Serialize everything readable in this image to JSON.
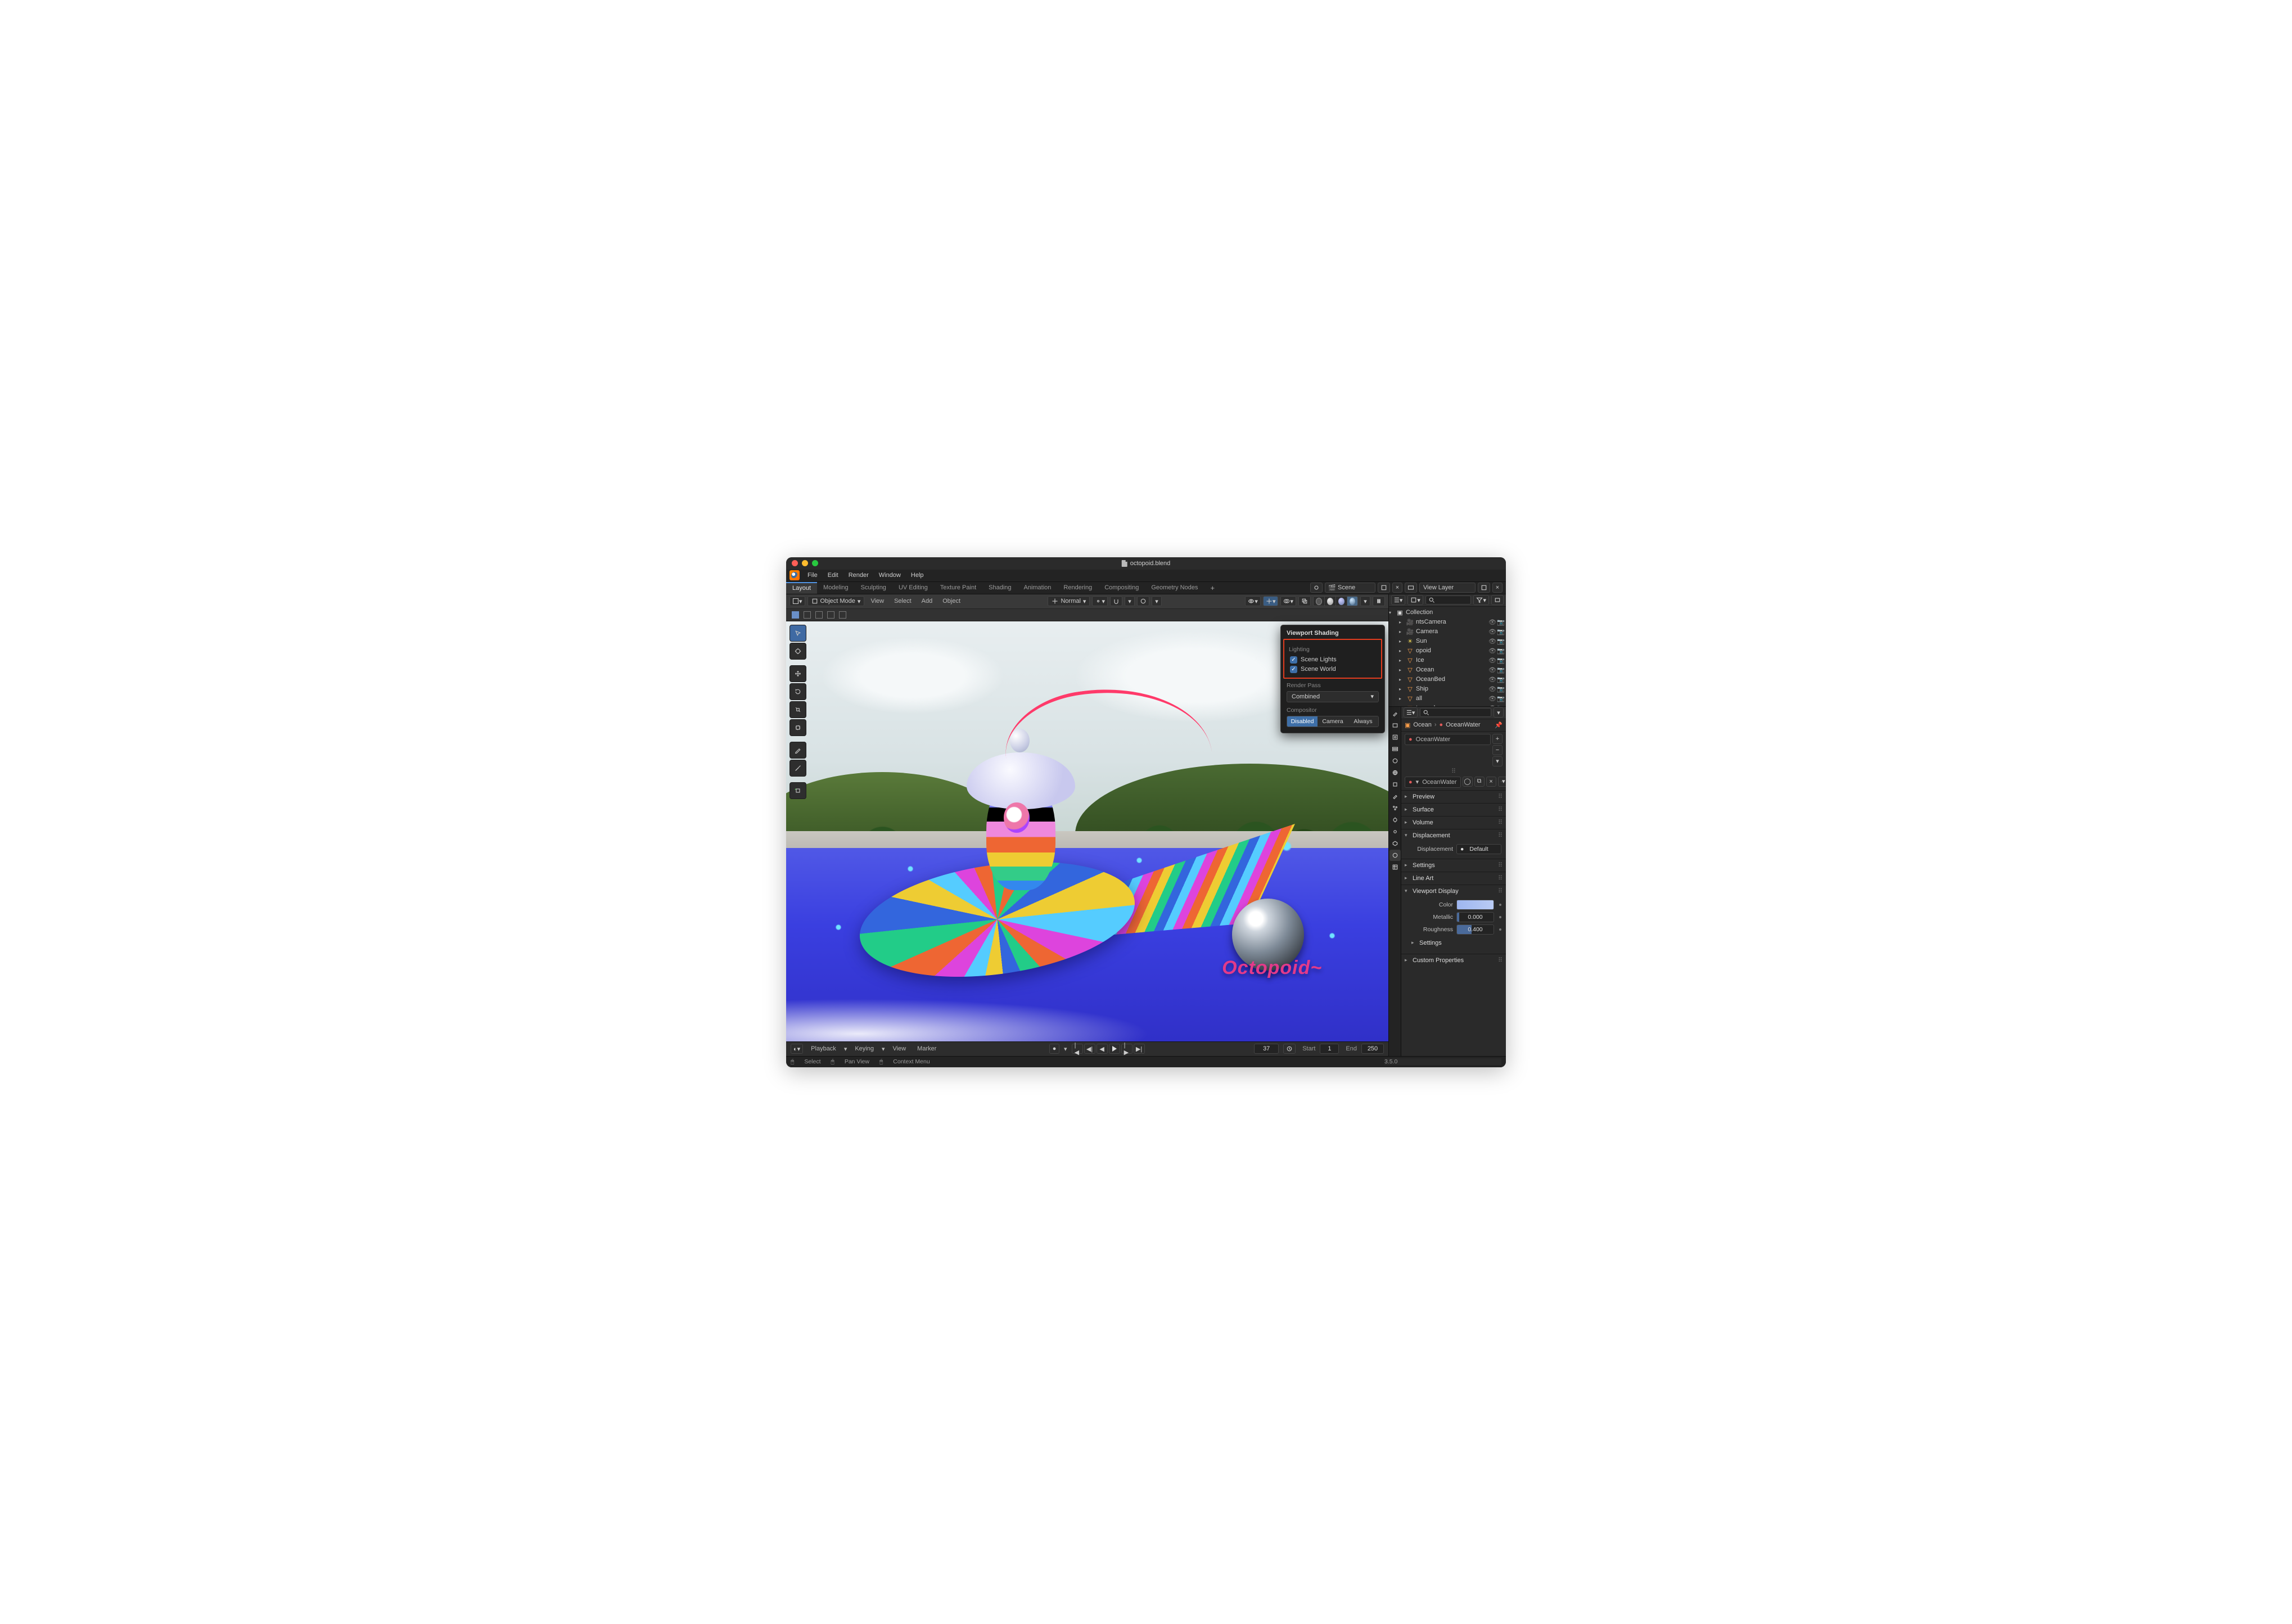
{
  "window": {
    "filename": "octopoid.blend"
  },
  "mainmenu": [
    "File",
    "Edit",
    "Render",
    "Window",
    "Help"
  ],
  "workspaces": {
    "tabs": [
      "Layout",
      "Modeling",
      "Sculpting",
      "UV Editing",
      "Texture Paint",
      "Shading",
      "Animation",
      "Rendering",
      "Compositing",
      "Geometry Nodes"
    ],
    "active": "Layout",
    "scene_label": "Scene",
    "viewlayer_label": "View Layer"
  },
  "viewport_header": {
    "mode": "Object Mode",
    "menus": [
      "View",
      "Select",
      "Add",
      "Object"
    ],
    "orientation": "Normal"
  },
  "popover": {
    "title": "Viewport Shading",
    "lighting_label": "Lighting",
    "scene_lights": "Scene Lights",
    "scene_world": "Scene World",
    "renderpass_label": "Render Pass",
    "renderpass_value": "Combined",
    "compositor_label": "Compositor",
    "comp_options": [
      "Disabled",
      "Camera",
      "Always"
    ],
    "comp_active": "Disabled"
  },
  "outliner": {
    "root": "Collection",
    "search_placeholder": "",
    "items": [
      {
        "name": "ntsCamera",
        "kind": "camera"
      },
      {
        "name": "Camera",
        "kind": "camera"
      },
      {
        "name": "Sun",
        "kind": "light"
      },
      {
        "name": "opoid",
        "kind": "mesh"
      },
      {
        "name": "Ice",
        "kind": "mesh"
      },
      {
        "name": "Ocean",
        "kind": "mesh"
      },
      {
        "name": "OceanBed",
        "kind": "mesh"
      },
      {
        "name": "Ship",
        "kind": "mesh"
      },
      {
        "name": "all",
        "kind": "mesh"
      },
      {
        "name": "termark",
        "kind": "mesh"
      }
    ]
  },
  "properties": {
    "crumb_object": "Ocean",
    "crumb_material": "OceanWater",
    "slot_material": "OceanWater",
    "datablock": "OceanWater",
    "panels": {
      "preview": "Preview",
      "surface": "Surface",
      "volume": "Volume",
      "displacement": "Displacement",
      "disp_label": "Displacement",
      "disp_value": "Default",
      "settings": "Settings",
      "lineart": "Line Art",
      "viewport": "Viewport Display",
      "color_label": "Color",
      "metallic_label": "Metallic",
      "metallic_value": "0.000",
      "roughness_label": "Roughness",
      "roughness_value": "0.400",
      "vp_settings": "Settings",
      "custom": "Custom Properties"
    }
  },
  "timeline": {
    "menus": [
      "Playback",
      "Keying",
      "View",
      "Marker"
    ],
    "current": "37",
    "start_label": "Start",
    "start": "1",
    "end_label": "End",
    "end": "250"
  },
  "status": {
    "select": "Select",
    "pan": "Pan View",
    "ctx": "Context Menu",
    "version": "3.5.0"
  },
  "scene_text": {
    "watermark": "Octopoid~"
  }
}
